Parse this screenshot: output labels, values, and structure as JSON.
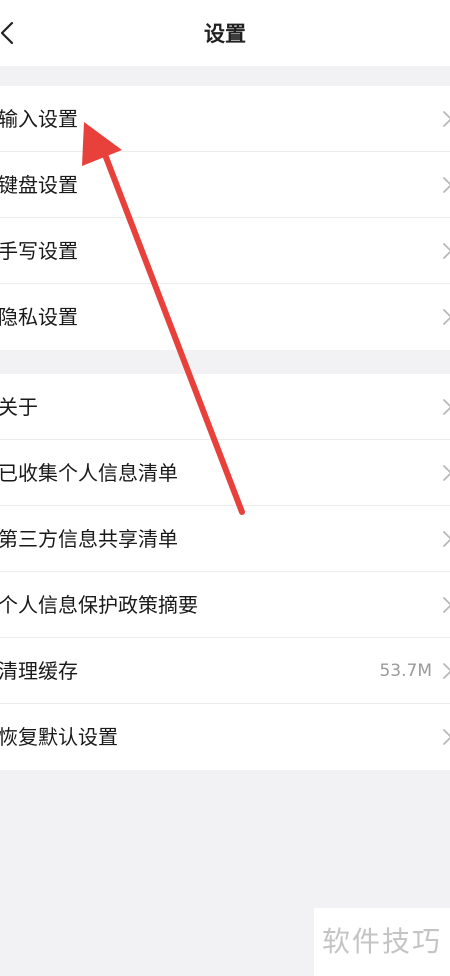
{
  "navbar": {
    "title": "设置",
    "back_icon": "chevron-left-icon"
  },
  "groups": [
    {
      "items": [
        {
          "label": "输入设置"
        },
        {
          "label": "键盘设置"
        },
        {
          "label": "手写设置"
        },
        {
          "label": "隐私设置"
        }
      ]
    },
    {
      "items": [
        {
          "label": "关于"
        },
        {
          "label": "已收集个人信息清单"
        },
        {
          "label": "第三方信息共享清单"
        },
        {
          "label": "个人信息保护政策摘要"
        },
        {
          "label": "清理缓存",
          "value": "53.7M"
        },
        {
          "label": "恢复默认设置"
        }
      ]
    }
  ],
  "annotation": {
    "arrow_color": "#e8403a"
  },
  "watermark": {
    "text": "软件技巧"
  },
  "colors": {
    "background": "#f2f2f4",
    "row_background": "#ffffff",
    "divider": "#ececec",
    "text_primary": "#1a1a1a",
    "text_secondary": "#9a9a9a"
  }
}
